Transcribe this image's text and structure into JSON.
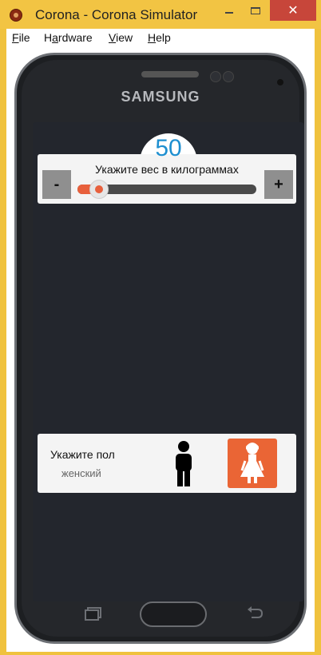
{
  "window": {
    "title": "Corona - Corona Simulator",
    "close_glyph": "✕"
  },
  "menu": [
    {
      "pre": "",
      "ul": "F",
      "post": "ile"
    },
    {
      "pre": "H",
      "ul": "a",
      "post": "rdware"
    },
    {
      "pre": "",
      "ul": "V",
      "post": "iew"
    },
    {
      "pre": "",
      "ul": "H",
      "post": "elp"
    }
  ],
  "device": {
    "brand": "SAMSUNG"
  },
  "weight": {
    "value": "50",
    "label": "Укажите вес в килограммах",
    "minus": "-",
    "plus": "+",
    "slider_fraction": 0.12
  },
  "gender": {
    "title": "Укажите пол",
    "value": "женский",
    "selected": "female"
  },
  "colors": {
    "accent": "#e8603c",
    "value_blue": "#1e8fd0"
  },
  "icons": {
    "app": "corona-logo-icon",
    "male": "male-figure-icon",
    "female": "female-figure-icon",
    "recents": "recents-icon",
    "back": "back-arrow-icon"
  }
}
